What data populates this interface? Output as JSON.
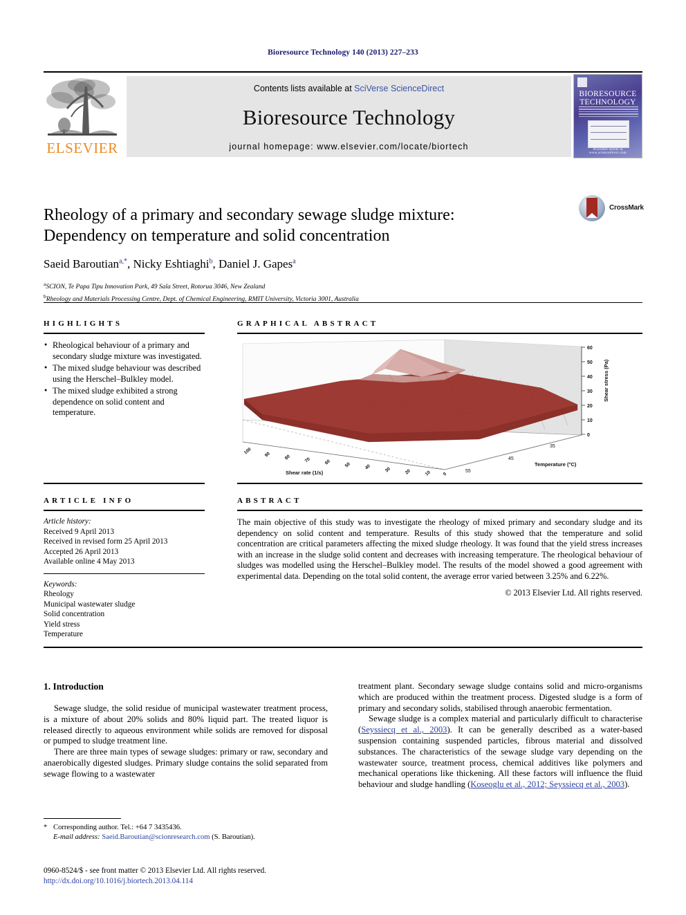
{
  "running_head": "Bioresource Technology 140 (2013) 227–233",
  "masthead": {
    "contents_prefix": "Contents lists available at ",
    "contents_link": "SciVerse ScienceDirect",
    "journal_title": "Bioresource Technology",
    "homepage": "journal homepage: www.elsevier.com/locate/biortech",
    "publisher": "ELSEVIER",
    "cover_title_line1": "BIORESOURCE",
    "cover_title_line2": "TECHNOLOGY",
    "cover_footer": "Available online at www.sciencedirect.com"
  },
  "article": {
    "title_line1": "Rheology of a primary and secondary sewage sludge mixture:",
    "title_line2": "Dependency on temperature and solid concentration",
    "crossmark_label": "CrossMark",
    "authors": [
      {
        "name": "Saeid Baroutian",
        "marks": "a,*"
      },
      {
        "name": "Nicky Eshtiaghi",
        "marks": "b"
      },
      {
        "name": "Daniel J. Gapes",
        "marks": "a"
      }
    ],
    "affiliations": [
      {
        "mark": "a",
        "text": "SCION, Te Papa Tipu Innovation Park, 49 Sala Street, Rotorua 3046, New Zealand"
      },
      {
        "mark": "b",
        "text": "Rheology and Materials Processing Centre, Dept. of Chemical Engineering, RMIT University, Victoria 3001, Australia"
      }
    ]
  },
  "highlights": {
    "label": "HIGHLIGHTS",
    "items": [
      "Rheological behaviour of a primary and secondary sludge mixture was investigated.",
      "The mixed sludge behaviour was described using the Herschel–Bulkley model.",
      "The mixed sludge exhibited a strong dependence on solid content and temperature."
    ]
  },
  "graphical_abstract": {
    "label": "GRAPHICAL ABSTRACT"
  },
  "chart_data": {
    "type": "surface",
    "title": "",
    "xlabel": "Shear rate (1/s)",
    "ylabel": "Temperature (°C)",
    "zlabel": "Shear stress (Pa)",
    "x_ticks": [
      "100",
      "90",
      "80",
      "70",
      "60",
      "50",
      "40",
      "30",
      "20",
      "10",
      "0"
    ],
    "y_ticks": [
      "35",
      "45",
      "55"
    ],
    "z_ticks": [
      "60",
      "50",
      "40",
      "30",
      "20",
      "10",
      "0"
    ],
    "zlim": [
      0,
      60
    ],
    "surface_color": "#9d3a33",
    "peak_color": "#d7a8a3",
    "grid": false,
    "description": "3D surface of shear stress versus shear rate and temperature; stress rises steeply at high shear rate and low temperature, peaking near 60 Pa.",
    "series": [
      {
        "name": "T = 35 °C",
        "x": [
          0,
          10,
          20,
          30,
          40,
          50,
          60,
          70,
          80,
          90,
          100
        ],
        "values": [
          16,
          22,
          27,
          31,
          35,
          39,
          43,
          47,
          51,
          56,
          60
        ]
      },
      {
        "name": "T = 45 °C",
        "x": [
          0,
          10,
          20,
          30,
          40,
          50,
          60,
          70,
          80,
          90,
          100
        ],
        "values": [
          12,
          17,
          21,
          24,
          27,
          29,
          31,
          33,
          34,
          35,
          36
        ]
      },
      {
        "name": "T = 55 °C",
        "x": [
          0,
          10,
          20,
          30,
          40,
          50,
          60,
          70,
          80,
          90,
          100
        ],
        "values": [
          9,
          13,
          16,
          18,
          20,
          21,
          22,
          23,
          24,
          25,
          26
        ]
      }
    ]
  },
  "article_info": {
    "label": "ARTICLE INFO",
    "history_heading": "Article history:",
    "history": [
      "Received 9 April 2013",
      "Received in revised form 25 April 2013",
      "Accepted 26 April 2013",
      "Available online 4 May 2013"
    ],
    "keywords_heading": "Keywords:",
    "keywords": [
      "Rheology",
      "Municipal wastewater sludge",
      "Solid concentration",
      "Yield stress",
      "Temperature"
    ]
  },
  "abstract": {
    "label": "ABSTRACT",
    "text": "The main objective of this study was to investigate the rheology of mixed primary and secondary sludge and its dependency on solid content and temperature. Results of this study showed that the temperature and solid concentration are critical parameters affecting the mixed sludge rheology. It was found that the yield stress increases with an increase in the sludge solid content and decreases with increasing temperature. The rheological behaviour of sludges was modelled using the Herschel–Bulkley model. The results of the model showed a good agreement with experimental data. Depending on the total solid content, the average error varied between 3.25% and 6.22%.",
    "copyright": "© 2013 Elsevier Ltd. All rights reserved."
  },
  "introduction": {
    "heading": "1. Introduction",
    "left_paragraphs": [
      "Sewage sludge, the solid residue of municipal wastewater treatment process, is a mixture of about 20% solids and 80% liquid part. The treated liquor is released directly to aqueous environment while solids are removed for disposal or pumped to sludge treatment line.",
      "There are three main types of sewage sludges: primary or raw, secondary and anaerobically digested sludges. Primary sludge contains the solid separated from sewage flowing to a wastewater"
    ],
    "right_paragraphs": [
      "treatment plant. Secondary sewage sludge contains solid and micro-organisms which are produced within the treatment process. Digested sludge is a form of primary and secondary solids, stabilised through anaerobic fermentation."
    ],
    "right_paragraph_2_part1": "Sewage sludge is a complex material and particularly difficult to characterise (",
    "right_paragraph_2_cite1": "Seyssiecq et al., 2003",
    "right_paragraph_2_part2": "). It can be generally described as a water-based suspension containing suspended particles, fibrous material and dissolved substances. The characteristics of the sewage sludge vary depending on the wastewater source, treatment process, chemical additives like polymers and mechanical operations like thickening. All these factors will influence the fluid behaviour and sludge handling (",
    "right_paragraph_2_cite2": "Koseoglu et al., 2012; Seyssiecq et al., 2003",
    "right_paragraph_2_part3": ")."
  },
  "footnotes": {
    "corresponding": "Corresponding author. Tel.: +64 7 3435436.",
    "email_label": "E-mail address:",
    "email": "Saeid.Baroutian@scionresearch.com",
    "email_owner": "(S. Baroutian).",
    "issn_line": "0960-8524/$ - see front matter © 2013 Elsevier Ltd. All rights reserved.",
    "doi_line": "http://dx.doi.org/10.1016/j.biortech.2013.04.114"
  }
}
